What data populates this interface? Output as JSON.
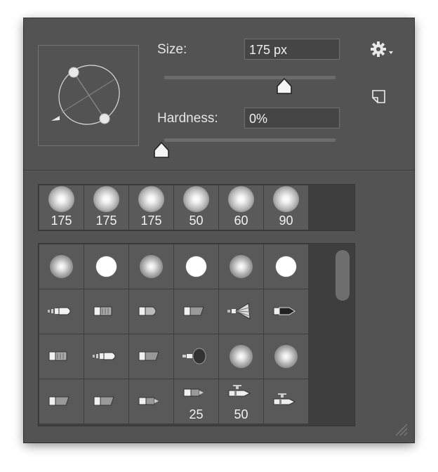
{
  "brush_options": {
    "size_label": "Size:",
    "size_value": "175 px",
    "size_slider_fraction": 0.7,
    "hardness_label": "Hardness:",
    "hardness_value": "0%",
    "hardness_slider_fraction": 0.0
  },
  "recent_brushes": [
    "175",
    "175",
    "175",
    "50",
    "60",
    "90"
  ],
  "preset_grid": [
    [
      {
        "kind": "soft",
        "label": ""
      },
      {
        "kind": "hard",
        "label": ""
      },
      {
        "kind": "soft",
        "label": ""
      },
      {
        "kind": "hard",
        "label": ""
      },
      {
        "kind": "soft",
        "label": ""
      },
      {
        "kind": "hard",
        "label": ""
      }
    ],
    [
      {
        "kind": "round-brush",
        "label": ""
      },
      {
        "kind": "flat-brush",
        "label": ""
      },
      {
        "kind": "filbert-brush",
        "label": ""
      },
      {
        "kind": "angled-brush",
        "label": ""
      },
      {
        "kind": "fan-brush",
        "label": ""
      },
      {
        "kind": "point-brush",
        "label": ""
      }
    ],
    [
      {
        "kind": "flat-brush",
        "label": ""
      },
      {
        "kind": "round-brush",
        "label": ""
      },
      {
        "kind": "angled-brush",
        "label": ""
      },
      {
        "kind": "mop-brush",
        "label": ""
      },
      {
        "kind": "soft",
        "label": ""
      },
      {
        "kind": "soft",
        "label": ""
      }
    ],
    [
      {
        "kind": "angled-brush",
        "label": ""
      },
      {
        "kind": "angled-brush",
        "label": ""
      },
      {
        "kind": "pencil",
        "label": ""
      },
      {
        "kind": "pencil",
        "label": "25"
      },
      {
        "kind": "airbrush",
        "label": "50"
      },
      {
        "kind": "airbrush",
        "label": ""
      }
    ]
  ],
  "icons": {
    "gear": "gear-icon",
    "new_preset": "new-preset-icon",
    "resize": "resize-grip-icon"
  },
  "colors": {
    "panel_bg": "#535353",
    "field_bg": "#454545",
    "text": "#e6e6e6"
  }
}
